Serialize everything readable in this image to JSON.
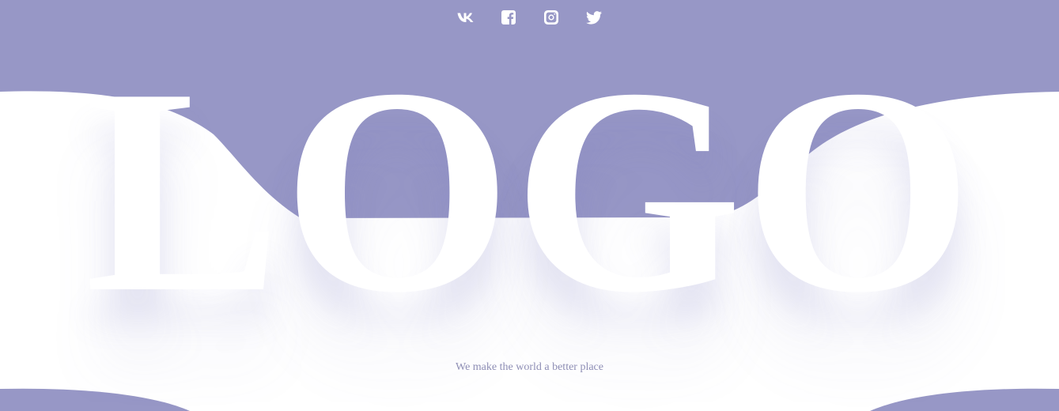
{
  "colors": {
    "accent": "#9797c6",
    "background": "#ffffff",
    "logo_text": "#ffffff",
    "tagline_text": "#8e8eb5"
  },
  "social": [
    {
      "name": "vk-icon"
    },
    {
      "name": "facebook-icon"
    },
    {
      "name": "instagram-icon"
    },
    {
      "name": "twitter-icon"
    }
  ],
  "logo": {
    "text": "LOGO"
  },
  "tagline": {
    "text": "We make the world a better place"
  }
}
